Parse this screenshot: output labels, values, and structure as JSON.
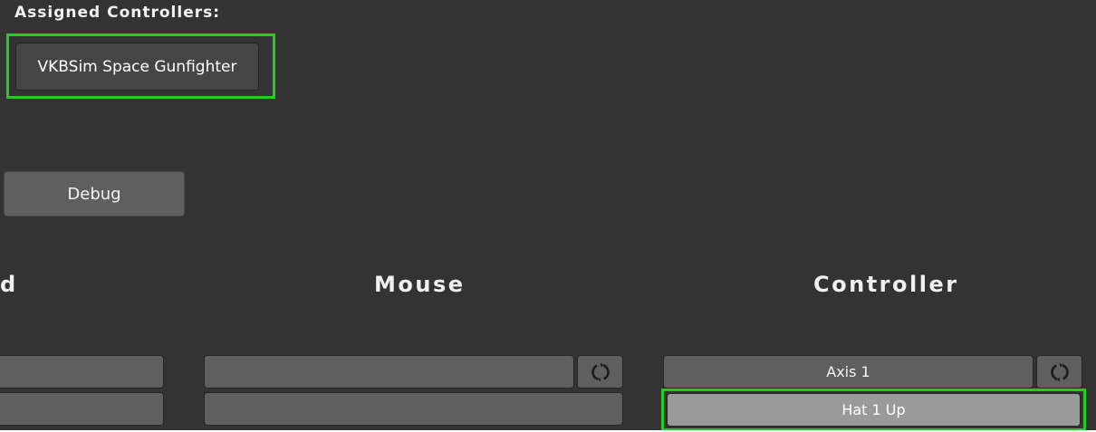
{
  "assigned": {
    "title": "Assigned Controllers:",
    "controllers": [
      "VKBSim Space Gunfighter"
    ]
  },
  "debug_label": "Debug",
  "columns": {
    "keyboard_partial": "d",
    "mouse": "Mouse",
    "controller": "Controller"
  },
  "bindings": {
    "keyboard": [
      "",
      ""
    ],
    "mouse": [
      "",
      ""
    ],
    "controller": [
      "Axis 1",
      "Hat 1 Up"
    ]
  },
  "icons": {
    "reset": "refresh-icon"
  },
  "colors": {
    "background": "#333333",
    "highlight": "#22cc22",
    "button": "#5f5f5f",
    "button_highlighted": "#9a9a9a"
  }
}
